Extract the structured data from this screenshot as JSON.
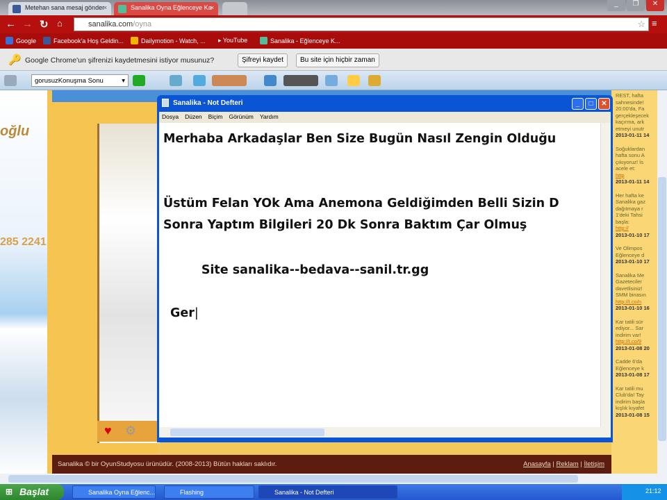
{
  "browser": {
    "tabs": [
      {
        "label": "Metehan sana mesaj gönder"
      },
      {
        "label": "Sanalika Oyna Eğlenceye Ka"
      }
    ],
    "url_host": "sanalika.com",
    "url_path": "/oyna",
    "bookmarks": [
      "Google",
      "Facebook'a Hoş Geldin...",
      "Dailymotion - Watch, ...",
      "YouTube",
      "Sanalika - Eğlenceye K..."
    ],
    "infobar": {
      "message": "Google Chrome'un şifrenizi kaydetmesini istiyor musunuz?",
      "save_button": "Şifreyi kaydet",
      "never_button": "Bu site için hiçbir zaman"
    },
    "extension_select": "gorusuzKonuşma Sonu"
  },
  "page": {
    "ad_phone": "285 2241",
    "news": [
      {
        "text": "REST, hafta sahnesinde! 20:00'da, Fa gerçekleşecek kaçırma, ark etmeyi unutr",
        "date": "2013-01-11 14"
      },
      {
        "text": "Soğuklardan hafta sonu A çıkıyoruz! İs acele et:",
        "link": "http",
        "date": "2013-01-11 14"
      },
      {
        "text": "Her hafta ke Sanalika gaz dağıtmaya r 1'deki Tahsi başla:",
        "link": "http://",
        "date": "2013-01-10 17"
      },
      {
        "text": "Ve Olimpos Eğlenceye d",
        "date": "2013-01-10 17"
      },
      {
        "text": "Sanalika Me Gazeteciler davetlisiniz! SMM binasın",
        "link": "http://t.co/n",
        "date": "2013-01-10 16"
      },
      {
        "text": "Kar tatili sür ediyor... Sar indirim var!",
        "link": "http://t.co/9",
        "date": "2013-01-08 20"
      },
      {
        "text": "Cadde 6'da Eğlenceye k",
        "date": "2013-01-08 17"
      },
      {
        "text": "Kar tatili mu Club'da! Tay indirim başla kışlık kıyafet",
        "date": "2013-01-08 15"
      }
    ],
    "footer": {
      "copyright": "Sanalika © bir OyunStudyosu ürünüdür. (2008-2013) Bütün hakları saklıdır.",
      "links": [
        "Anasayfa",
        "Reklam",
        "İletişim"
      ]
    }
  },
  "notepad": {
    "title": "Sanalika - Not Defteri",
    "menu": [
      "Dosya",
      "Düzen",
      "Biçim",
      "Görünüm",
      "Yardım"
    ],
    "lines": [
      "Merhaba Arkadaşlar Ben Size Bugün Nasıl Zengin Olduğu",
      "",
      "",
      "Üstüm Felan YOk Ama Anemona Geldiğimden Belli Sizin D",
      "Sonra Yaptım Bilgileri 20 Dk Sonra Baktım Çar Olmuş",
      "",
      "         Site sanalika--bedava--sanil.tr.gg",
      "",
      "Ger"
    ]
  },
  "taskbar": {
    "start": "Başlat",
    "tasks": [
      "Sanalika Oyna Eğlenc...",
      "Flashing",
      "Sanalika - Not Defteri"
    ],
    "clock": "21:12"
  }
}
